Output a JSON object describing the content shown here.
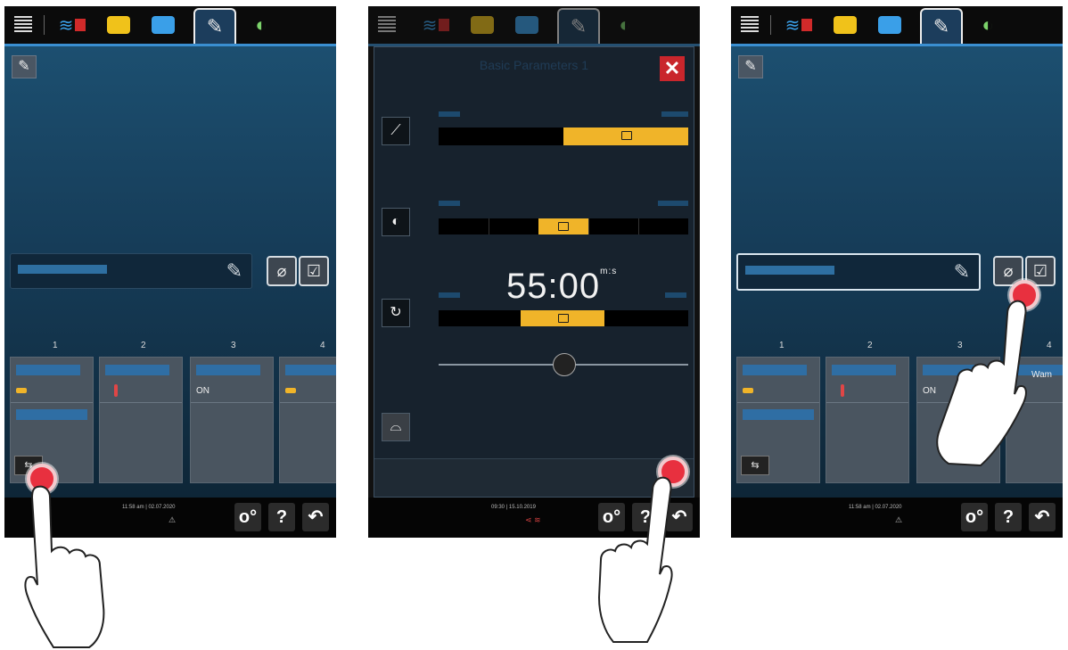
{
  "tabs": {
    "menu": "menu-icon",
    "cooking_modes": "cooking-modes-icon",
    "pot": "pot-icon",
    "tray": "tray-icon",
    "edit": "edit-icon",
    "cleaning": "cleaning-icon"
  },
  "panel1": {
    "steps": [
      {
        "number": "1",
        "info": ""
      },
      {
        "number": "2",
        "info": ""
      },
      {
        "number": "3",
        "info": "ON"
      },
      {
        "number": "4",
        "info": ""
      }
    ],
    "status_time": "11:58 am | 02.07.2020",
    "warning_symbol": "⚠"
  },
  "panel2": {
    "dialog_title": "Basic Parameters 1",
    "cooking_time": "55:00",
    "time_unit": "m:s",
    "status_time": "09:30 | 15.10.2019"
  },
  "panel3": {
    "steps": [
      {
        "number": "1",
        "info": ""
      },
      {
        "number": "2",
        "info": ""
      },
      {
        "number": "3",
        "info": "ON"
      },
      {
        "number": "4",
        "info": "Wam"
      }
    ],
    "status_time": "11:58 am | 02.07.2020",
    "warning_symbol": "⚠"
  },
  "buttons": {
    "settings": "o°",
    "help": "?",
    "back": "↶"
  },
  "colors": {
    "accent_blue": "#3a8fd1",
    "accent_yellow": "#f0b429",
    "close_red": "#c9262c",
    "touch_red": "#e8303f"
  }
}
